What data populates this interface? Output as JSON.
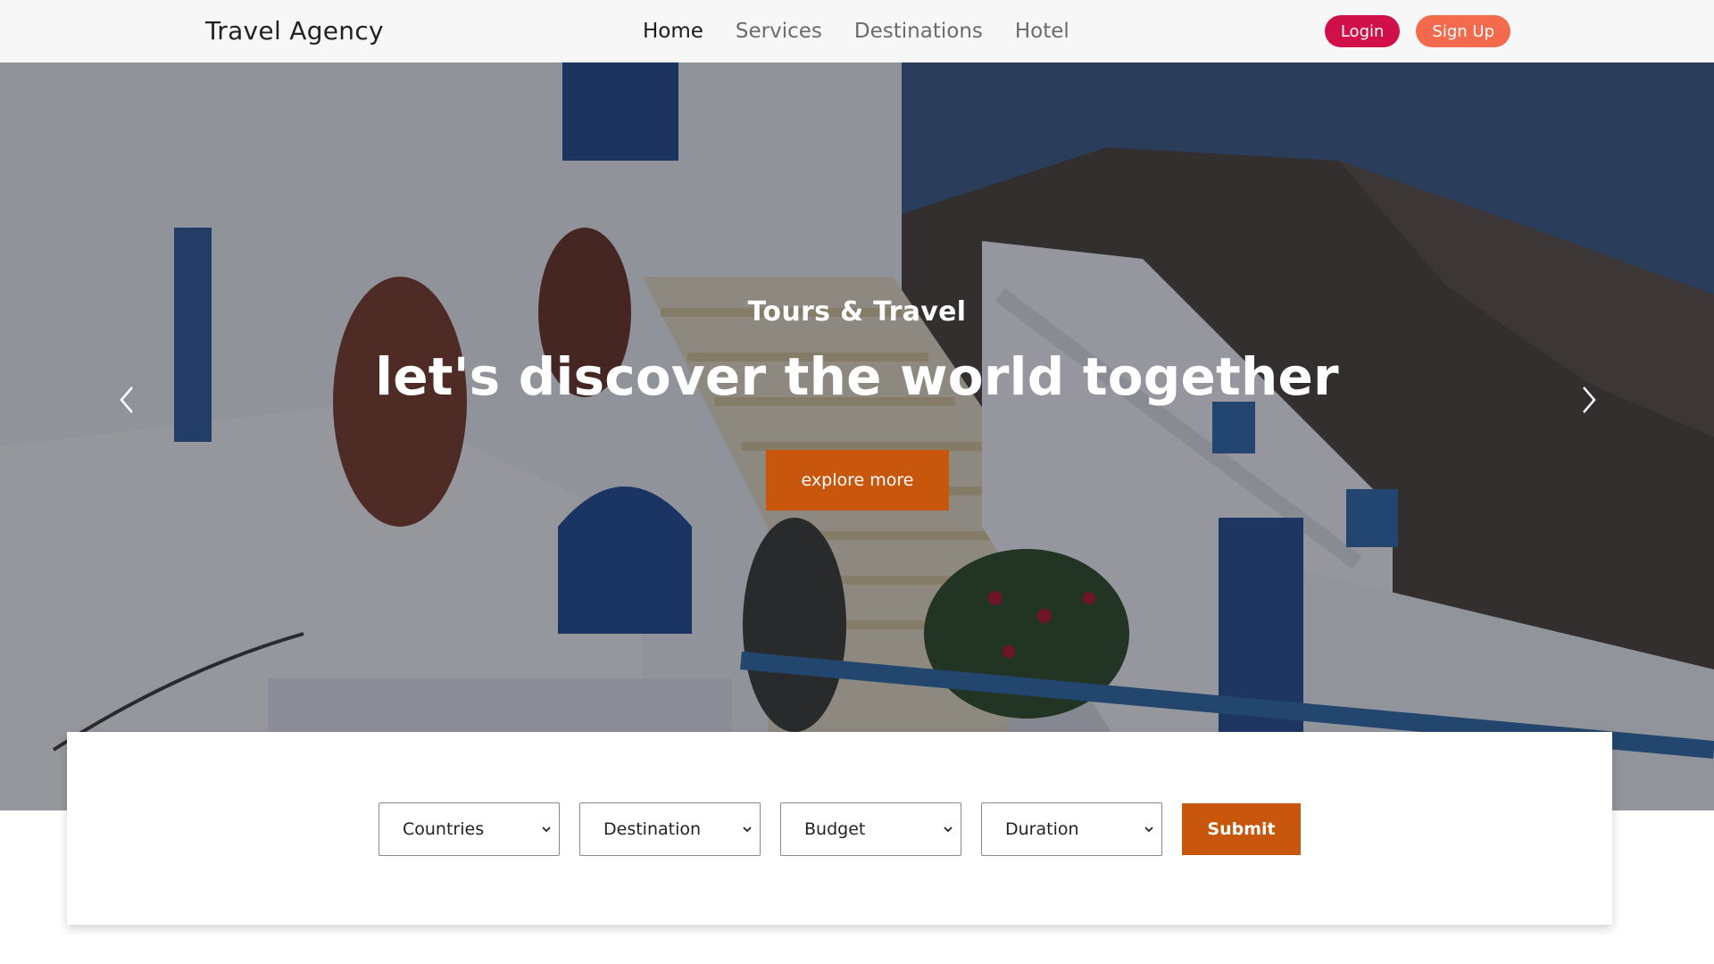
{
  "header": {
    "brand": "Travel Agency",
    "nav": [
      {
        "label": "Home",
        "active": true
      },
      {
        "label": "Services",
        "active": false
      },
      {
        "label": "Destinations",
        "active": false
      },
      {
        "label": "Hotel",
        "active": false
      }
    ],
    "login_label": "Login",
    "signup_label": "Sign Up"
  },
  "hero": {
    "subtitle": "Tours & Travel",
    "title": "let's discover the world together",
    "cta_label": "explore more",
    "prev_icon": "chevron-left-icon",
    "next_icon": "chevron-right-icon"
  },
  "search": {
    "countries_label": "Countries",
    "destination_label": "Destination",
    "budget_label": "Budget",
    "duration_label": "Duration",
    "submit_label": "Submit"
  },
  "colors": {
    "header_bg": "#f7f7f7",
    "login_bg": "#d1104a",
    "signup_bg": "#f36a4d",
    "accent_orange": "#c9560d",
    "hero_overlay": "rgba(20,22,34,0.42)"
  }
}
